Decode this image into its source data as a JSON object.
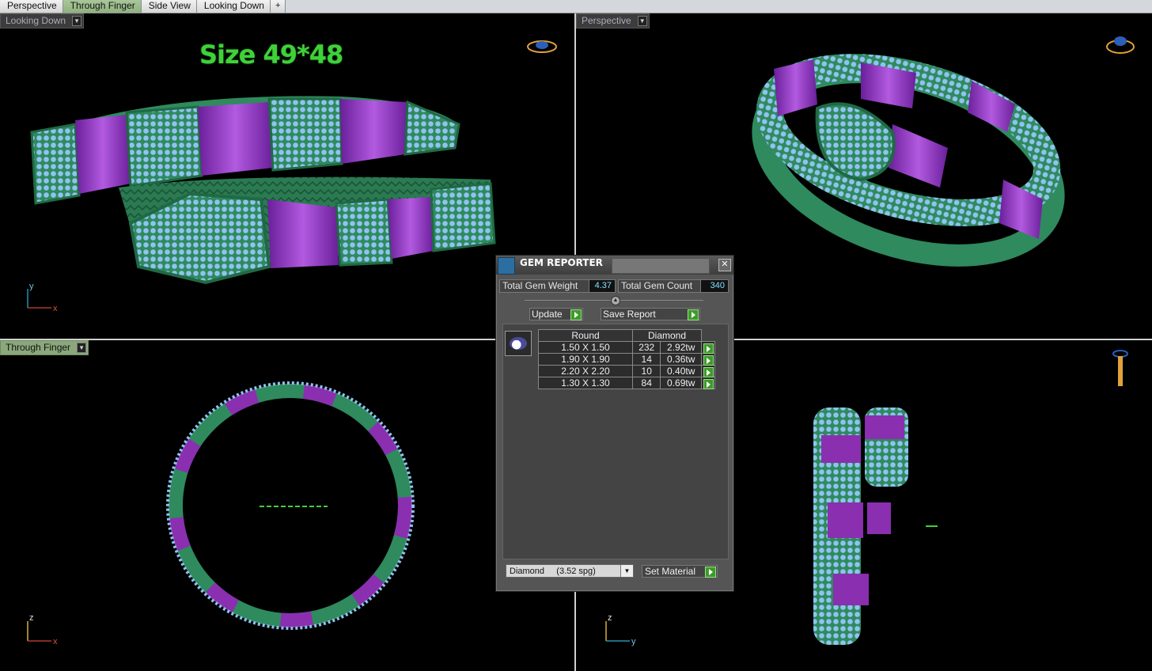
{
  "tabs": [
    "Perspective",
    "Through Finger",
    "Side View",
    "Looking Down",
    "+"
  ],
  "viewports": {
    "top_left": {
      "label": "Looking Down",
      "size_text": "Size 49*48",
      "axes": [
        "y",
        "x"
      ]
    },
    "top_right": {
      "label": "Perspective"
    },
    "bottom_left": {
      "label": "Through Finger",
      "axes": [
        "z",
        "x"
      ]
    },
    "bottom_right": {
      "axes": [
        "z",
        "y"
      ]
    }
  },
  "dialog": {
    "title": "GEM REPORTER",
    "total_weight_label": "Total Gem Weight",
    "total_weight_value": "4.37",
    "total_count_label": "Total Gem Count",
    "total_count_value": "340",
    "update_label": "Update",
    "save_label": "Save Report",
    "table_headers": [
      "Round",
      "Diamond"
    ],
    "rows": [
      {
        "size": "1.50 X 1.50",
        "count": "232",
        "weight": "2.92tw"
      },
      {
        "size": "1.90 X 1.90",
        "count": "14",
        "weight": "0.36tw"
      },
      {
        "size": "2.20 X 2.20",
        "count": "10",
        "weight": "0.40tw"
      },
      {
        "size": "1.30 X 1.30",
        "count": "84",
        "weight": "0.69tw"
      }
    ],
    "material_value": "Diamond     (3.52 spg)",
    "set_material_label": "Set Material"
  },
  "colors": {
    "green_band": "#2f8a5e",
    "purple_band": "#8a2fb0",
    "gems": "#8fc3f0"
  }
}
